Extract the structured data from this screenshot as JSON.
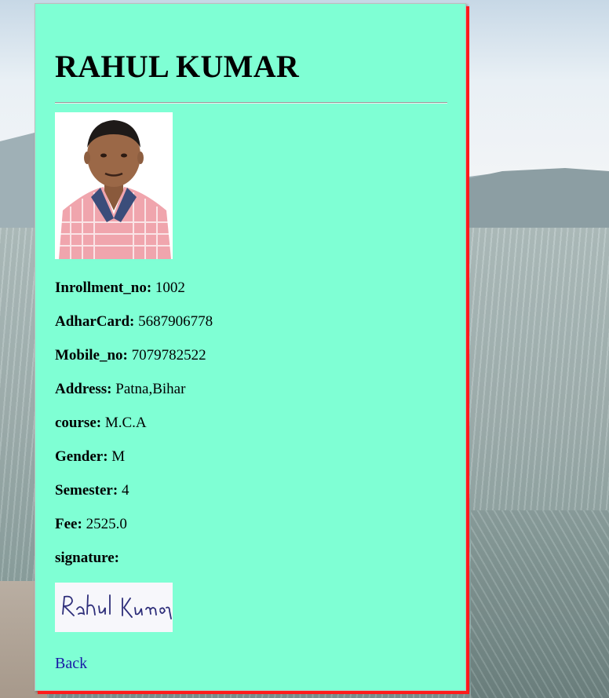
{
  "student": {
    "name": "RAHUL KUMAR",
    "fields": [
      {
        "label": "Inrollment_no:",
        "value": " 1002"
      },
      {
        "label": "AdharCard:",
        "value": " 5687906778"
      },
      {
        "label": "Mobile_no:",
        "value": " 7079782522"
      },
      {
        "label": "Address:",
        "value": " Patna,Bihar"
      },
      {
        "label": "course:",
        "value": " M.C.A"
      },
      {
        "label": "Gender:",
        "value": " M"
      },
      {
        "label": "Semester:",
        "value": " 4"
      },
      {
        "label": "Fee:",
        "value": " 2525.0"
      }
    ],
    "signature_label": "signature:",
    "signature_text": "Rahul Kumar"
  },
  "nav": {
    "back_label": "Back"
  },
  "colors": {
    "card_bg": "#7fffd4",
    "card_shadow": "#ff1a1a",
    "link": "#1a1aa6"
  },
  "icons": {
    "photo": "profile-photo",
    "signature": "signature-image"
  }
}
